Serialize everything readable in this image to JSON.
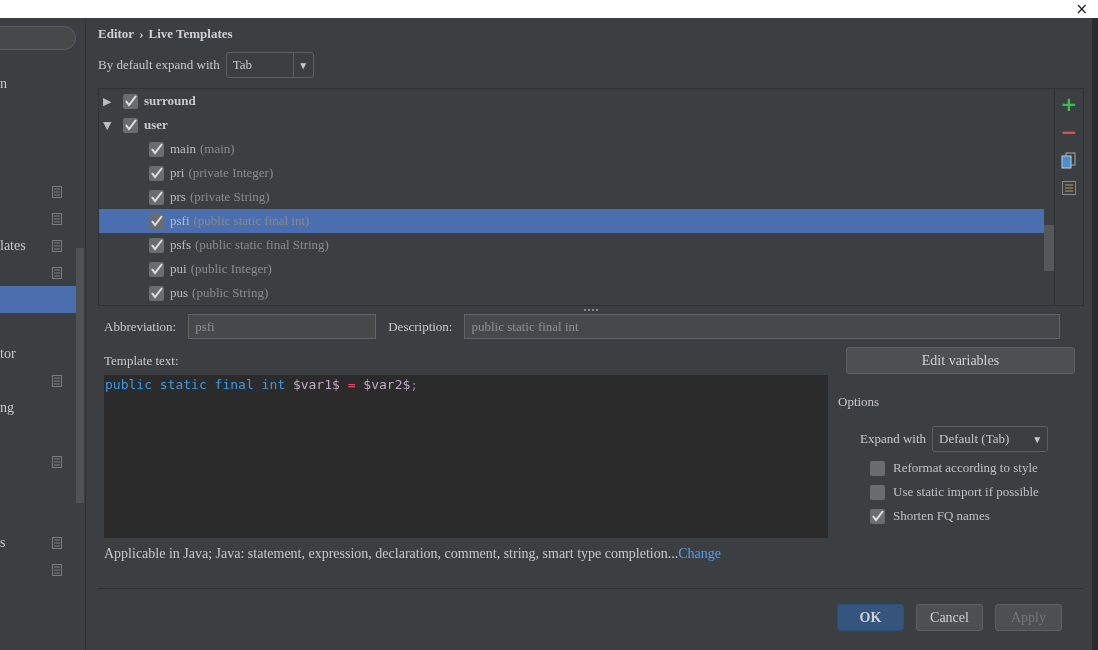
{
  "window": {
    "close": "×"
  },
  "sidebar": {
    "items": [
      {
        "text": "n",
        "icon": false,
        "selected": false
      },
      {
        "icon": false,
        "selected": false
      },
      {
        "icon": false,
        "selected": false
      },
      {
        "icon": false,
        "selected": false
      },
      {
        "icon": true,
        "selected": false
      },
      {
        "icon": true,
        "selected": false
      },
      {
        "text": "lates",
        "icon": true,
        "selected": false
      },
      {
        "icon": true,
        "selected": false
      },
      {
        "icon": false,
        "selected": true
      },
      {
        "icon": false,
        "selected": false
      },
      {
        "text": "tor",
        "icon": false,
        "selected": false
      },
      {
        "icon": true,
        "selected": false
      },
      {
        "text": "ng",
        "icon": false,
        "selected": false
      },
      {
        "icon": false,
        "selected": false
      },
      {
        "icon": true,
        "selected": false
      },
      {
        "icon": false,
        "selected": false
      },
      {
        "icon": false,
        "selected": false
      },
      {
        "text": "s",
        "icon": true,
        "selected": false
      },
      {
        "icon": true,
        "selected": false
      }
    ]
  },
  "breadcrumb": [
    "Editor",
    "›",
    "Live Templates"
  ],
  "expand_default": {
    "label": "By default expand with",
    "value": "Tab",
    "arrow": "▼"
  },
  "tree": [
    {
      "name": "surround",
      "checked": true,
      "expanded": false
    },
    {
      "name": "user",
      "checked": true,
      "expanded": true,
      "children": [
        {
          "name": "main",
          "desc": "(main)",
          "checked": true,
          "selected": false
        },
        {
          "name": "pri",
          "desc": "(private Integer)",
          "checked": true,
          "selected": false
        },
        {
          "name": "prs",
          "desc": "(private String)",
          "checked": true,
          "selected": false
        },
        {
          "name": "psfi",
          "desc": "(public static final int)",
          "checked": true,
          "selected": true
        },
        {
          "name": "psfs",
          "desc": "(public static final String)",
          "checked": true,
          "selected": false
        },
        {
          "name": "pui",
          "desc": "(public Integer)",
          "checked": true,
          "selected": false
        },
        {
          "name": "pus",
          "desc": "(public String)",
          "checked": true,
          "selected": false
        }
      ]
    }
  ],
  "tree_arrows": {
    "collapsed": "▶",
    "expanded": "▼"
  },
  "toolbar": [
    {
      "kind": "add",
      "text": "+"
    },
    {
      "kind": "remove",
      "text": "−"
    },
    {
      "kind": "copy"
    },
    {
      "kind": "list"
    }
  ],
  "abbreviation": {
    "label": "Abbreviation:",
    "value": "psfi"
  },
  "description": {
    "label": "Description:",
    "value": "public static final int"
  },
  "template_text": {
    "label": "Template text:",
    "tokens": [
      {
        "kind": "keyword",
        "text": "public "
      },
      {
        "kind": "keyword",
        "text": "static "
      },
      {
        "kind": "keyword",
        "text": "final "
      },
      {
        "kind": "keyword",
        "text": "int "
      },
      {
        "kind": "variable",
        "text": "$var1$ "
      },
      {
        "kind": "operator",
        "text": "= "
      },
      {
        "kind": "variable",
        "text": "$var2$"
      },
      {
        "kind": "punct",
        "text": ";"
      }
    ]
  },
  "applicable": {
    "text": "Applicable in Java; Java: statement, expression, declaration, comment, string, smart type completion...",
    "link": "Change"
  },
  "edit_variables": "Edit variables",
  "options": {
    "title": "Options",
    "expand_label": "Expand with",
    "expand_value": "Default (Tab)",
    "arrow": "▼",
    "checkboxes": [
      {
        "label": "Reformat according to style",
        "checked": false
      },
      {
        "label": "Use static import if possible",
        "checked": false
      },
      {
        "label": "Shorten FQ names",
        "checked": true
      }
    ]
  },
  "buttons": [
    {
      "label": "OK",
      "kind": "default",
      "disabled": false
    },
    {
      "label": "Cancel",
      "kind": "normal",
      "disabled": false
    },
    {
      "label": "Apply",
      "kind": "normal",
      "disabled": true
    }
  ]
}
